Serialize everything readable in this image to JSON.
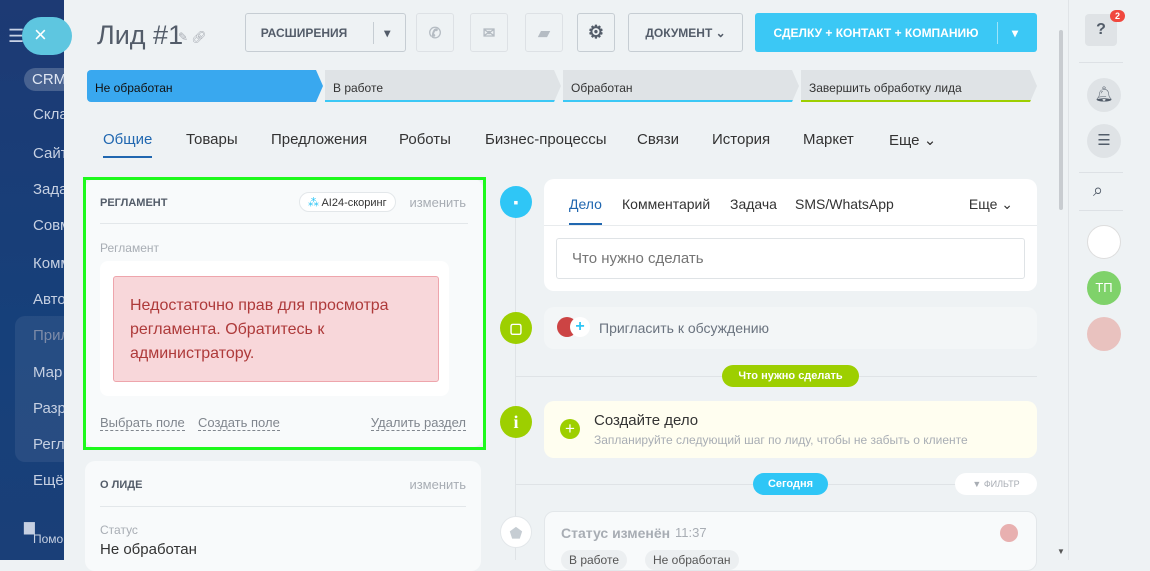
{
  "sidebar": {
    "items": [
      "CRM",
      "Скла",
      "Сайт",
      "Зада",
      "Совм",
      "Комм",
      "Авто",
      "Прил",
      "Мар",
      "Разр",
      "Регл",
      "Ещё",
      "Помо"
    ]
  },
  "header": {
    "title": "Лид #1",
    "extensions": "РАСШИРЕНИЯ",
    "document": "ДОКУМЕНТ",
    "primary": "СДЕЛКУ + КОНТАКТ + КОМПАНИЮ"
  },
  "stages": [
    {
      "label": "Не обработан"
    },
    {
      "label": "В работе"
    },
    {
      "label": "Обработан"
    },
    {
      "label": "Завершить обработку лида"
    }
  ],
  "tabs": [
    "Общие",
    "Товары",
    "Предложения",
    "Роботы",
    "Бизнес-процессы",
    "Связи",
    "История",
    "Маркет",
    "Еще"
  ],
  "reglament": {
    "title": "РЕГЛАМЕНТ",
    "badge": "AI24-скоринг",
    "edit": "изменить",
    "field_label": "Регламент",
    "error": "Недостаточно прав для просмотра регламента. Обратитесь к администратору.",
    "select_field": "Выбрать поле",
    "create_field": "Создать поле",
    "delete_section": "Удалить раздел"
  },
  "about": {
    "title": "О ЛИДЕ",
    "edit": "изменить",
    "status_label": "Статус",
    "status_value": "Не обработан"
  },
  "timeline": {
    "tabs": [
      "Дело",
      "Комментарий",
      "Задача",
      "SMS/WhatsApp"
    ],
    "more": "Еще",
    "placeholder": "Что нужно сделать",
    "invite": "Пригласить к обсуждению",
    "todo_pill": "Что нужно сделать",
    "create_title": "Создайте дело",
    "create_sub": "Запланируйте следующий шаг по лиду, чтобы не забыть о клиенте",
    "today": "Сегодня",
    "filter": "ФИЛЬТР",
    "event_title": "Статус изменён",
    "event_time": "11:37",
    "event_from": "В работе",
    "event_to": "Не обработан"
  },
  "right": {
    "help_badge": "2",
    "user_initials": "ТП"
  }
}
